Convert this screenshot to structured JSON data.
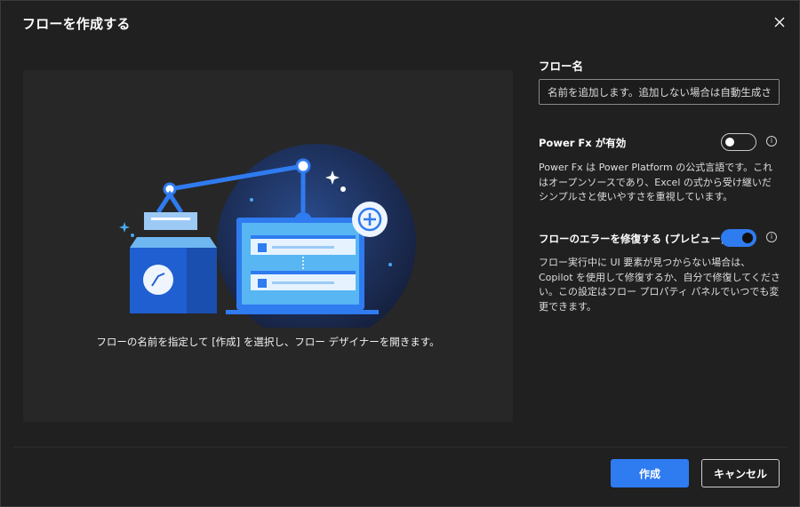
{
  "dialog": {
    "title": "フローを作成する",
    "close_icon": "close-icon"
  },
  "illustration": {
    "caption": "フローの名前を指定して [作成] を選択し、フロー デザイナーを開きます。",
    "icon": "robot-arm-laptop-illustration"
  },
  "flow_name": {
    "label": "フロー名",
    "value": "",
    "placeholder": "名前を追加します。追加しない場合は自動生成さ..."
  },
  "power_fx": {
    "label": "Power Fx が有効",
    "enabled": false,
    "info_icon": "info-icon",
    "description": "Power Fx は Power Platform の公式言語です。これはオープンソースであり、Excel の式から受け継いだシンプルさと使いやすさを重視しています。"
  },
  "error_repair": {
    "label": "フローのエラーを修復する (プレビュー)",
    "enabled": true,
    "info_icon": "info-icon",
    "description": "フロー実行中に UI 要素が見つからない場合は、Copilot を使用して修復するか、自分で修復してください。この設定はフロー プロパティ パネルでいつでも変更できます。"
  },
  "footer": {
    "create_label": "作成",
    "cancel_label": "キャンセル"
  },
  "colors": {
    "accent": "#2f7bf0",
    "background": "#202020",
    "panel": "#272727"
  }
}
